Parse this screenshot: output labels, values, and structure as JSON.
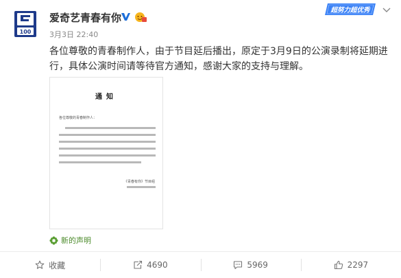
{
  "post": {
    "author": "爱奇艺青春有你",
    "avatar_text": "100",
    "date": "3月3日 22:40",
    "banner_text": "超努力超优秀",
    "text": "各位尊敬的青春制作人，由于节目延后播出，原定于3月9日的公演录制将延期进行，具体公演时间请等待官方通知，感谢大家的支持与理解。"
  },
  "notice": {
    "title": "通知",
    "greeting": "各位尊敬的青春制作人：",
    "signature": "《青春有你》节目组"
  },
  "footnote": "新的声明",
  "actions": {
    "collect": "收藏",
    "repost": "4690",
    "comment": "5969",
    "like": "2297"
  },
  "colors": {
    "avatar_blue": "#1e3a8a",
    "verified_blue": "#1e6fd9",
    "banner_blue": "#3b82f6",
    "footnote_green": "#4c8b2b"
  }
}
